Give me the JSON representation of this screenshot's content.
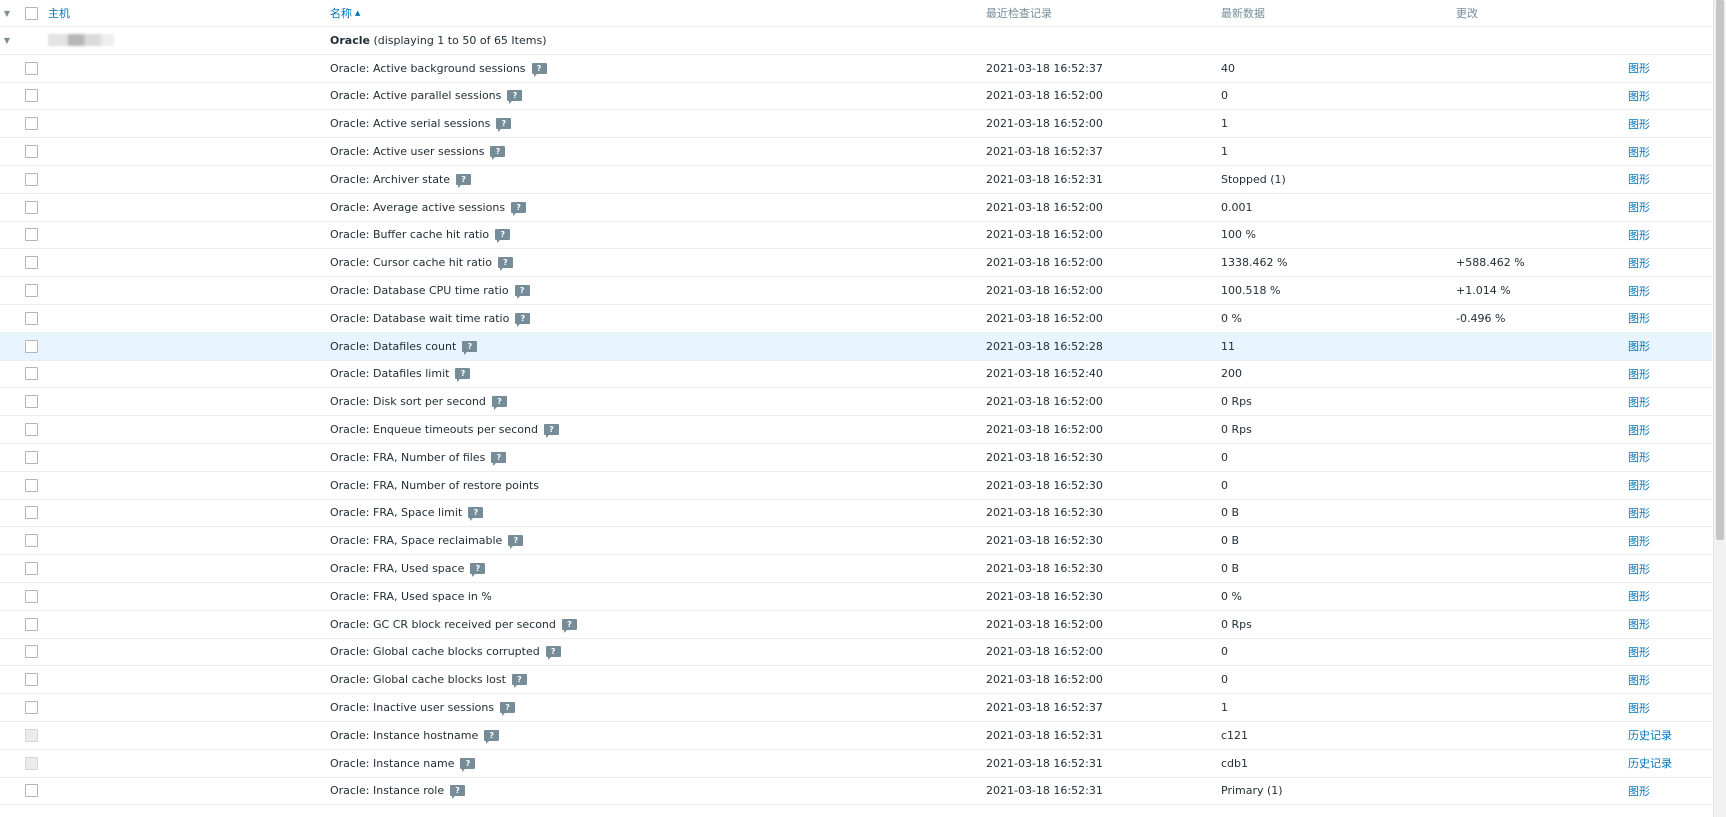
{
  "header": {
    "host": "主机",
    "name": "名称",
    "sort_indicator": "▲",
    "last_check": "最近检查记录",
    "latest_data": "最新数据",
    "change": "更改"
  },
  "group": {
    "name": "Oracle",
    "info": "(displaying 1 to 50 of 65 Items)"
  },
  "rows": [
    {
      "name": "Oracle: Active background sessions",
      "tip": true,
      "time": "2021-03-18 16:52:37",
      "value": "40",
      "change": "",
      "action": "图形"
    },
    {
      "name": "Oracle: Active parallel sessions",
      "tip": true,
      "time": "2021-03-18 16:52:00",
      "value": "0",
      "change": "",
      "action": "图形"
    },
    {
      "name": "Oracle: Active serial sessions",
      "tip": true,
      "time": "2021-03-18 16:52:00",
      "value": "1",
      "change": "",
      "action": "图形"
    },
    {
      "name": "Oracle: Active user sessions",
      "tip": true,
      "time": "2021-03-18 16:52:37",
      "value": "1",
      "change": "",
      "action": "图形"
    },
    {
      "name": "Oracle: Archiver state",
      "tip": true,
      "time": "2021-03-18 16:52:31",
      "value": "Stopped (1)",
      "change": "",
      "action": "图形"
    },
    {
      "name": "Oracle: Average active sessions",
      "tip": true,
      "time": "2021-03-18 16:52:00",
      "value": "0.001",
      "change": "",
      "action": "图形"
    },
    {
      "name": "Oracle: Buffer cache hit ratio",
      "tip": true,
      "time": "2021-03-18 16:52:00",
      "value": "100 %",
      "change": "",
      "action": "图形"
    },
    {
      "name": "Oracle: Cursor cache hit ratio",
      "tip": true,
      "time": "2021-03-18 16:52:00",
      "value": "1338.462 %",
      "change": "+588.462 %",
      "action": "图形"
    },
    {
      "name": "Oracle: Database CPU time ratio",
      "tip": true,
      "time": "2021-03-18 16:52:00",
      "value": "100.518 %",
      "change": "+1.014 %",
      "action": "图形"
    },
    {
      "name": "Oracle: Database wait time ratio",
      "tip": true,
      "time": "2021-03-18 16:52:00",
      "value": "0 %",
      "change": "-0.496 %",
      "action": "图形"
    },
    {
      "name": "Oracle: Datafiles count",
      "tip": true,
      "time": "2021-03-18 16:52:28",
      "value": "11",
      "change": "",
      "action": "图形",
      "highlight": true
    },
    {
      "name": "Oracle: Datafiles limit",
      "tip": true,
      "time": "2021-03-18 16:52:40",
      "value": "200",
      "change": "",
      "action": "图形"
    },
    {
      "name": "Oracle: Disk sort per second",
      "tip": true,
      "time": "2021-03-18 16:52:00",
      "value": "0 Rps",
      "change": "",
      "action": "图形"
    },
    {
      "name": "Oracle: Enqueue timeouts per second",
      "tip": true,
      "time": "2021-03-18 16:52:00",
      "value": "0 Rps",
      "change": "",
      "action": "图形"
    },
    {
      "name": "Oracle: FRA, Number of files",
      "tip": true,
      "time": "2021-03-18 16:52:30",
      "value": "0",
      "change": "",
      "action": "图形"
    },
    {
      "name": "Oracle: FRA, Number of restore points",
      "tip": false,
      "time": "2021-03-18 16:52:30",
      "value": "0",
      "change": "",
      "action": "图形"
    },
    {
      "name": "Oracle: FRA, Space limit",
      "tip": true,
      "time": "2021-03-18 16:52:30",
      "value": "0 B",
      "change": "",
      "action": "图形"
    },
    {
      "name": "Oracle: FRA, Space reclaimable",
      "tip": true,
      "time": "2021-03-18 16:52:30",
      "value": "0 B",
      "change": "",
      "action": "图形"
    },
    {
      "name": "Oracle: FRA, Used space",
      "tip": true,
      "time": "2021-03-18 16:52:30",
      "value": "0 B",
      "change": "",
      "action": "图形"
    },
    {
      "name": "Oracle: FRA, Used space in %",
      "tip": false,
      "time": "2021-03-18 16:52:30",
      "value": "0 %",
      "change": "",
      "action": "图形"
    },
    {
      "name": "Oracle: GC CR block received per second",
      "tip": true,
      "time": "2021-03-18 16:52:00",
      "value": "0 Rps",
      "change": "",
      "action": "图形"
    },
    {
      "name": "Oracle: Global cache blocks corrupted",
      "tip": true,
      "time": "2021-03-18 16:52:00",
      "value": "0",
      "change": "",
      "action": "图形"
    },
    {
      "name": "Oracle: Global cache blocks lost",
      "tip": true,
      "time": "2021-03-18 16:52:00",
      "value": "0",
      "change": "",
      "action": "图形"
    },
    {
      "name": "Oracle: Inactive user sessions",
      "tip": true,
      "time": "2021-03-18 16:52:37",
      "value": "1",
      "change": "",
      "action": "图形"
    },
    {
      "name": "Oracle: Instance hostname",
      "tip": true,
      "time": "2021-03-18 16:52:31",
      "value": "c121",
      "change": "",
      "action": "历史记录",
      "disabled": true
    },
    {
      "name": "Oracle: Instance name",
      "tip": true,
      "time": "2021-03-18 16:52:31",
      "value": "cdb1",
      "change": "",
      "action": "历史记录",
      "disabled": true
    },
    {
      "name": "Oracle: Instance role",
      "tip": true,
      "time": "2021-03-18 16:52:31",
      "value": "Primary (1)",
      "change": "",
      "action": "图形"
    }
  ]
}
